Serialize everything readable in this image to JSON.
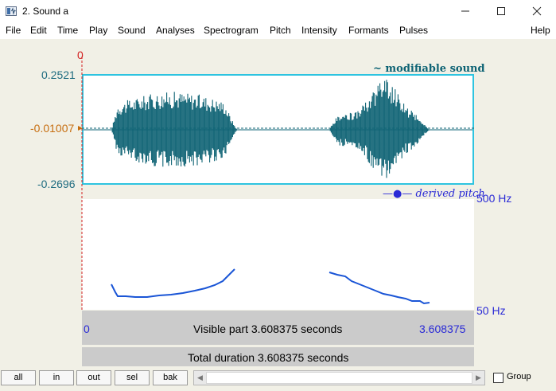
{
  "window": {
    "title": "2. Sound a"
  },
  "menu": [
    "File",
    "Edit",
    "Time",
    "Play",
    "Sound",
    "Analyses",
    "Spectrogram",
    "Pitch",
    "Intensity",
    "Formants",
    "Pulses",
    "Help"
  ],
  "waveform": {
    "cursor_label": "0",
    "top_value": "0.2521",
    "cursor_value": "-0.01007",
    "bottom_value": "-0.2696",
    "legend": "~ modifiable sound",
    "color": "#0e6374",
    "frame_color": "#2ec4e0"
  },
  "pitch": {
    "legend": "—●— derived pitch",
    "top_value": "500 Hz",
    "bottom_value": "50 Hz",
    "color": "#1a55d6"
  },
  "timebar": {
    "left_value": "0",
    "visible_label": "Visible part 3.608375 seconds",
    "right_value": "3.608375",
    "total_label": "Total duration 3.608375 seconds"
  },
  "buttons": {
    "all": "all",
    "in": "in",
    "out": "out",
    "sel": "sel",
    "bak": "bak"
  },
  "group": {
    "label": "Group",
    "checked": false
  }
}
